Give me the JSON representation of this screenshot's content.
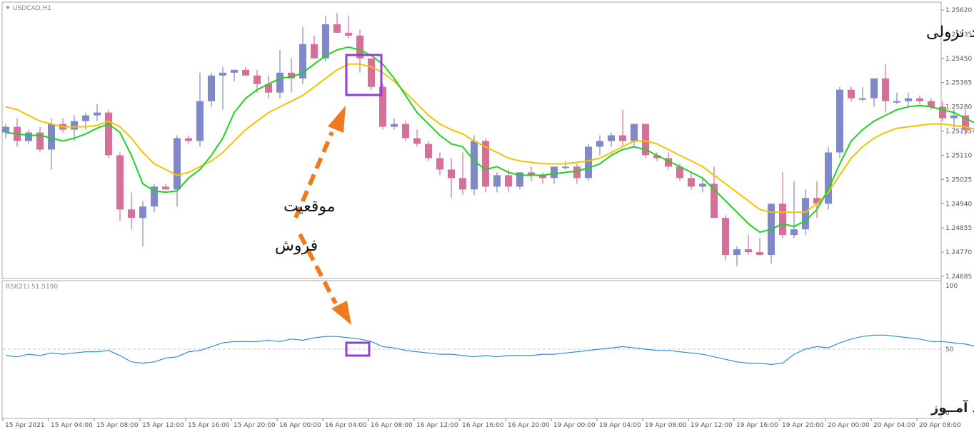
{
  "symbol": "USDCAD,H1",
  "title": "روند نزولی",
  "sell_label_line1": "موقعیت",
  "sell_label_line2": "فروش",
  "footer_text": "انتشار در وبسایت ســود آمــوز",
  "rsi_label": "RSI(21) 51.5190",
  "colors": {
    "bull": "#7f88c8",
    "bear": "#d66f9a",
    "ma_fast": "#1ed21e",
    "ma_slow": "#f2c400",
    "rsi": "#2f8fd6",
    "highlight": "#9340c8",
    "arrow": "#f07a1e"
  },
  "chart_data": [
    {
      "type": "candlestick",
      "ylim": [
        1.24685,
        1.2562
      ],
      "y_ticks": [
        "1.25620",
        "1.25535",
        "1.25450",
        "1.25365",
        "1.25280",
        "1.25195",
        "1.25110",
        "1.25025",
        "1.24940",
        "1.24855",
        "1.24770",
        "1.24685"
      ],
      "x_ticks": [
        "15 Apr 2021",
        "15 Apr 04:00",
        "15 Apr 08:00",
        "15 Apr 12:00",
        "15 Apr 16:00",
        "15 Apr 20:00",
        "16 Apr 00:00",
        "16 Apr 04:00",
        "16 Apr 08:00",
        "16 Apr 12:00",
        "16 Apr 16:00",
        "16 Apr 20:00",
        "19 Apr 00:00",
        "19 Apr 04:00",
        "19 Apr 08:00",
        "19 Apr 12:00",
        "19 Apr 16:00",
        "19 Apr 20:00",
        "20 Apr 00:00",
        "20 Apr 04:00",
        "20 Apr 08:00"
      ],
      "candles": [
        [
          1.2519,
          1.2522,
          1.2517,
          1.2521
        ],
        [
          1.2521,
          1.2524,
          1.2514,
          1.2516
        ],
        [
          1.2516,
          1.252,
          1.2515,
          1.2519
        ],
        [
          1.2519,
          1.2521,
          1.2512,
          1.2513
        ],
        [
          1.2513,
          1.2524,
          1.2506,
          1.2522
        ],
        [
          1.2522,
          1.2524,
          1.2519,
          1.252
        ],
        [
          1.252,
          1.2525,
          1.2516,
          1.2523
        ],
        [
          1.2523,
          1.2526,
          1.252,
          1.2525
        ],
        [
          1.2525,
          1.2529,
          1.2523,
          1.2526
        ],
        [
          1.2526,
          1.2527,
          1.251,
          1.2511
        ],
        [
          1.2511,
          1.2512,
          1.2488,
          1.2492
        ],
        [
          1.2492,
          1.2498,
          1.2485,
          1.2489
        ],
        [
          1.2489,
          1.2495,
          1.2479,
          1.2493
        ],
        [
          1.2493,
          1.2501,
          1.2491,
          1.25
        ],
        [
          1.25,
          1.2501,
          1.2499,
          1.2499
        ],
        [
          1.2499,
          1.2518,
          1.2493,
          1.2517
        ],
        [
          1.2517,
          1.2518,
          1.2515,
          1.2516
        ],
        [
          1.2516,
          1.254,
          1.2514,
          1.253
        ],
        [
          1.253,
          1.254,
          1.2528,
          1.2539
        ],
        [
          1.2539,
          1.2542,
          1.2527,
          1.254
        ],
        [
          1.254,
          1.2541,
          1.2537,
          1.2541
        ],
        [
          1.2541,
          1.2542,
          1.2539,
          1.2539
        ],
        [
          1.2539,
          1.2541,
          1.2533,
          1.2536
        ],
        [
          1.2536,
          1.2539,
          1.2531,
          1.2533
        ],
        [
          1.2533,
          1.2548,
          1.2531,
          1.254
        ],
        [
          1.254,
          1.2545,
          1.2533,
          1.2538
        ],
        [
          1.2538,
          1.2556,
          1.2536,
          1.255
        ],
        [
          1.255,
          1.2553,
          1.2545,
          1.2545
        ],
        [
          1.2545,
          1.256,
          1.2544,
          1.2557
        ],
        [
          1.2557,
          1.2561,
          1.2554,
          1.2554
        ],
        [
          1.2554,
          1.256,
          1.2552,
          1.2553
        ],
        [
          1.2553,
          1.2555,
          1.254,
          1.2545
        ],
        [
          1.2545,
          1.2545,
          1.2534,
          1.2535
        ],
        [
          1.2535,
          1.2536,
          1.252,
          1.2521
        ],
        [
          1.2521,
          1.2524,
          1.252,
          1.2522
        ],
        [
          1.2522,
          1.2523,
          1.2516,
          1.2517
        ],
        [
          1.2517,
          1.252,
          1.2514,
          1.2515
        ],
        [
          1.2515,
          1.2516,
          1.2509,
          1.251
        ],
        [
          1.251,
          1.2512,
          1.2504,
          1.2506
        ],
        [
          1.2506,
          1.251,
          1.2496,
          1.2503
        ],
        [
          1.2503,
          1.2512,
          1.2497,
          1.2499
        ],
        [
          1.2499,
          1.2518,
          1.2497,
          1.2516
        ],
        [
          1.2516,
          1.2517,
          1.2498,
          1.25
        ],
        [
          1.25,
          1.2505,
          1.2498,
          1.2504
        ],
        [
          1.2504,
          1.2506,
          1.2498,
          1.25
        ],
        [
          1.25,
          1.2505,
          1.2499,
          1.2505
        ],
        [
          1.2505,
          1.2507,
          1.2502,
          1.2504
        ],
        [
          1.2504,
          1.2505,
          1.2501,
          1.2503
        ],
        [
          1.2503,
          1.2507,
          1.2501,
          1.2507
        ],
        [
          1.2507,
          1.2509,
          1.2506,
          1.2507
        ],
        [
          1.2507,
          1.2508,
          1.2501,
          1.2503
        ],
        [
          1.2503,
          1.2515,
          1.2502,
          1.2514
        ],
        [
          1.2514,
          1.2518,
          1.2511,
          1.2516
        ],
        [
          1.2516,
          1.2519,
          1.2514,
          1.2518
        ],
        [
          1.2518,
          1.2527,
          1.2514,
          1.2516
        ],
        [
          1.2516,
          1.2522,
          1.2514,
          1.2522
        ],
        [
          1.2522,
          1.2522,
          1.251,
          1.2511
        ],
        [
          1.2511,
          1.2512,
          1.2509,
          1.251
        ],
        [
          1.251,
          1.2512,
          1.2506,
          1.2507
        ],
        [
          1.2507,
          1.2508,
          1.2502,
          1.2503
        ],
        [
          1.2503,
          1.2505,
          1.2499,
          1.25
        ],
        [
          1.25,
          1.2503,
          1.2498,
          1.2501
        ],
        [
          1.2501,
          1.2507,
          1.2489,
          1.2489
        ],
        [
          1.2489,
          1.249,
          1.2474,
          1.2476
        ],
        [
          1.2476,
          1.2479,
          1.2472,
          1.2478
        ],
        [
          1.2478,
          1.2483,
          1.2476,
          1.2477
        ],
        [
          1.2477,
          1.2482,
          1.2476,
          1.2476
        ],
        [
          1.2476,
          1.2493,
          1.2473,
          1.2494
        ],
        [
          1.2494,
          1.2505,
          1.2482,
          1.2483
        ],
        [
          1.2483,
          1.2502,
          1.2482,
          1.2485
        ],
        [
          1.2485,
          1.2499,
          1.2483,
          1.2496
        ],
        [
          1.2496,
          1.2502,
          1.2489,
          1.2494
        ],
        [
          1.2494,
          1.2514,
          1.2492,
          1.2512
        ],
        [
          1.2512,
          1.2535,
          1.251,
          1.2534
        ],
        [
          1.2534,
          1.2535,
          1.253,
          1.2531
        ],
        [
          1.2531,
          1.2535,
          1.253,
          1.2531
        ],
        [
          1.2531,
          1.2536,
          1.2528,
          1.2538
        ],
        [
          1.2538,
          1.2543,
          1.2526,
          1.253
        ],
        [
          1.253,
          1.2533,
          1.2529,
          1.253
        ],
        [
          1.253,
          1.2533,
          1.2528,
          1.2531
        ],
        [
          1.2531,
          1.2532,
          1.2529,
          1.253
        ],
        [
          1.253,
          1.2531,
          1.2527,
          1.2528
        ],
        [
          1.2528,
          1.253,
          1.2523,
          1.2524
        ],
        [
          1.2524,
          1.2527,
          1.252,
          1.2525
        ],
        [
          1.2525,
          1.2527,
          1.2518,
          1.252
        ],
        [
          1.252,
          1.2523,
          1.2516,
          1.2519
        ],
        [
          1.2519,
          1.252,
          1.2507,
          1.2508
        ],
        [
          1.2508,
          1.251,
          1.2503,
          1.2504
        ],
        [
          1.2504,
          1.2505,
          1.249,
          1.2491
        ],
        [
          1.2491,
          1.2495,
          1.2488,
          1.249
        ],
        [
          1.249,
          1.2493,
          1.2489,
          1.2489
        ],
        [
          1.2489,
          1.2495,
          1.2487,
          1.2493
        ],
        [
          1.2493,
          1.2498,
          1.2479,
          1.2495
        ]
      ],
      "ma_fast": [
        1.2519,
        1.25185,
        1.2518,
        1.2518,
        1.2517,
        1.2516,
        1.2517,
        1.25185,
        1.25205,
        1.2522,
        1.2519,
        1.2511,
        1.2501,
        1.24985,
        1.2498,
        1.24985,
        1.2503,
        1.2506,
        1.2511,
        1.2517,
        1.2526,
        1.2531,
        1.2534,
        1.2536,
        1.2538,
        1.25385,
        1.254,
        1.2543,
        1.2546,
        1.2548,
        1.2549,
        1.2548,
        1.2546,
        1.2543,
        1.2538,
        1.2532,
        1.2526,
        1.2522,
        1.2518,
        1.2515,
        1.2514,
        1.2509,
        1.2506,
        1.2507,
        1.2505,
        1.2504,
        1.2504,
        1.2504,
        1.25045,
        1.2505,
        1.25055,
        1.25065,
        1.2508,
        1.2511,
        1.2513,
        1.2514,
        1.2513,
        1.2511,
        1.2509,
        1.2507,
        1.2505,
        1.2503,
        1.2499,
        1.2495,
        1.2491,
        1.2487,
        1.2484,
        1.2485,
        1.2487,
        1.2486,
        1.2488,
        1.2492,
        1.2499,
        1.2508,
        1.2516,
        1.252,
        1.2523,
        1.2525,
        1.2527,
        1.2528,
        1.25285,
        1.2528,
        1.2527,
        1.2526,
        1.2524,
        1.2522,
        1.2518,
        1.2513,
        1.2507,
        1.2502,
        1.2497,
        1.2495,
        1.2494,
        1.2493
      ],
      "ma_slow": [
        1.2528,
        1.2527,
        1.2525,
        1.2523,
        1.2522,
        1.2521,
        1.2521,
        1.2521,
        1.25215,
        1.2523,
        1.2521,
        1.2517,
        1.2512,
        1.2508,
        1.2506,
        1.2504,
        1.2505,
        1.2507,
        1.2509,
        1.2512,
        1.2516,
        1.252,
        1.2523,
        1.2526,
        1.2528,
        1.253,
        1.2532,
        1.2535,
        1.2538,
        1.2541,
        1.2543,
        1.2543,
        1.2542,
        1.254,
        1.2537,
        1.2533,
        1.2529,
        1.2525,
        1.2522,
        1.252,
        1.25185,
        1.2516,
        1.2514,
        1.2512,
        1.251,
        1.2509,
        1.25085,
        1.2508,
        1.2508,
        1.2508,
        1.25085,
        1.2509,
        1.251,
        1.2512,
        1.2514,
        1.2516,
        1.2516,
        1.2515,
        1.2513,
        1.2511,
        1.2509,
        1.2507,
        1.2504,
        1.2501,
        1.2498,
        1.2495,
        1.2492,
        1.2491,
        1.2491,
        1.2491,
        1.2491,
        1.2494,
        1.2498,
        1.2504,
        1.251,
        1.2514,
        1.2517,
        1.2519,
        1.25205,
        1.2521,
        1.25215,
        1.2522,
        1.2522,
        1.25215,
        1.2521,
        1.252,
        1.2518,
        1.2516,
        1.2513,
        1.251,
        1.2507,
        1.2505,
        1.2504,
        1.2503
      ]
    },
    {
      "type": "line",
      "name": "RSI(21)",
      "ylim": [
        0,
        100
      ],
      "y_ticks": [
        "100",
        "50",
        "0"
      ],
      "level": 50,
      "values": [
        45,
        44,
        46,
        45,
        47,
        46,
        47,
        48,
        48,
        49,
        45,
        40,
        39,
        40,
        43,
        44,
        48,
        49,
        52,
        55,
        56,
        56,
        56,
        57,
        56,
        58,
        57,
        59,
        60,
        60,
        59,
        58,
        56,
        52,
        51,
        49,
        48,
        47,
        46,
        46,
        45,
        44,
        45,
        44,
        45,
        45,
        45,
        46,
        46,
        47,
        48,
        49,
        50,
        51,
        52,
        51,
        50,
        49,
        49,
        48,
        47,
        46,
        44,
        42,
        40,
        39,
        39,
        38,
        39,
        46,
        50,
        52,
        51,
        55,
        58,
        60,
        61,
        61,
        60,
        59,
        58,
        56,
        56,
        55,
        54,
        52,
        50,
        48,
        46,
        45,
        45,
        44,
        45,
        46
      ]
    }
  ]
}
